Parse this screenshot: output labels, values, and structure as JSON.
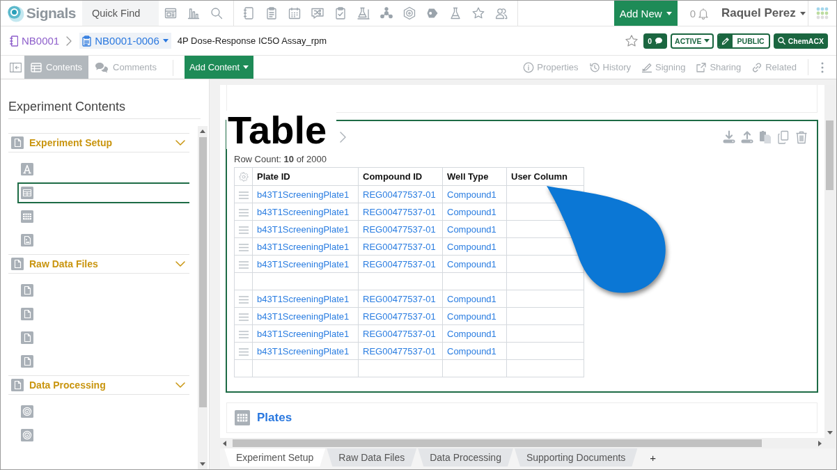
{
  "top_bar": {
    "logo": "Signals",
    "quick_find": "Quick Find",
    "add_new": "Add New",
    "notifications": "0",
    "user": "Raquel Perez"
  },
  "breadcrumb": {
    "notebook": "NB0001",
    "experiment": "NB0001-0006",
    "title": "4P Dose-Response IC5O Assay_rpm",
    "comments": "0",
    "status": "ACTIVE",
    "visibility": "PUBLIC",
    "lookup": "ChemACX"
  },
  "toolbar": {
    "views": [
      {
        "kind": "contents",
        "label": "Contents",
        "selected": true
      },
      {
        "kind": "comments",
        "label": "Comments",
        "selected": false
      }
    ],
    "add_content": "Add Content",
    "actions": [
      {
        "kind": "properties",
        "label": "Properties"
      },
      {
        "kind": "history",
        "label": "History"
      },
      {
        "kind": "signing",
        "label": "Signing"
      },
      {
        "kind": "sharing",
        "label": "Sharing"
      },
      {
        "kind": "related",
        "label": "Related"
      }
    ]
  },
  "sidebar": {
    "title": "Experiment Contents",
    "sections": [
      {
        "label": "Experiment Setup",
        "expanded": true,
        "items": [
          {
            "kind": "text",
            "selected": false
          },
          {
            "kind": "table",
            "selected": true
          },
          {
            "kind": "plate",
            "selected": false
          },
          {
            "kind": "image",
            "selected": false
          }
        ]
      },
      {
        "label": "Raw Data Files",
        "expanded": true,
        "items": [
          {
            "kind": "file",
            "selected": false
          },
          {
            "kind": "file",
            "selected": false
          },
          {
            "kind": "file",
            "selected": false
          },
          {
            "kind": "file",
            "selected": false
          }
        ]
      },
      {
        "label": "Data Processing",
        "expanded": true,
        "items": [
          {
            "kind": "target",
            "selected": false
          },
          {
            "kind": "target",
            "selected": false
          }
        ]
      }
    ]
  },
  "table_card": {
    "annotation": "Table",
    "row_count": "Row Count: **10** of 2000",
    "columns": [
      "Plate ID",
      "Compound ID",
      "Well Type",
      "User Column"
    ],
    "rows": [
      {
        "kind": "data",
        "cells": [
          "b43T1ScreeningPlate1",
          "REG00477537-01",
          "Compound1"
        ]
      },
      {
        "kind": "data",
        "cells": [
          "b43T1ScreeningPlate1",
          "REG00477537-01",
          "Compound1"
        ]
      },
      {
        "kind": "data",
        "cells": [
          "b43T1ScreeningPlate1",
          "REG00477537-01",
          "Compound1"
        ]
      },
      {
        "kind": "data",
        "cells": [
          "b43T1ScreeningPlate1",
          "REG00477537-01",
          "Compound1"
        ]
      },
      {
        "kind": "data",
        "cells": [
          "b43T1ScreeningPlate1",
          "REG00477537-01",
          "Compound1"
        ]
      },
      {
        "kind": "blank"
      },
      {
        "kind": "data",
        "cells": [
          "b43T1ScreeningPlate1",
          "REG00477537-01",
          "Compound1"
        ]
      },
      {
        "kind": "data",
        "cells": [
          "b43T1ScreeningPlate1",
          "REG00477537-01",
          "Compound1"
        ]
      },
      {
        "kind": "data",
        "cells": [
          "b43T1ScreeningPlate1",
          "REG00477537-01",
          "Compound1"
        ]
      },
      {
        "kind": "data",
        "cells": [
          "b43T1ScreeningPlate1",
          "REG00477537-01",
          "Compound1"
        ]
      },
      {
        "kind": "blank"
      }
    ]
  },
  "plates_card": {
    "title": "Plates"
  },
  "sheet_tabs": [
    {
      "label": "Experiment Setup",
      "selected": true
    },
    {
      "label": "Raw Data Files",
      "selected": false
    },
    {
      "label": "Data Processing",
      "selected": false
    },
    {
      "label": "Supporting Documents",
      "selected": false
    }
  ],
  "add_sheet": "+"
}
